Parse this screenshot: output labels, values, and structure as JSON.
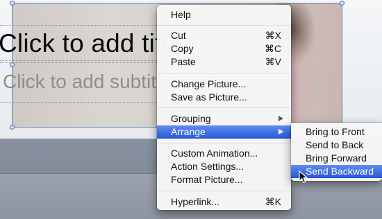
{
  "slide": {
    "title_placeholder": "Click to add title",
    "subtitle_placeholder": "Click to add subtitle"
  },
  "context_menu": {
    "items": [
      {
        "label": "Help",
        "shortcut": ""
      },
      {
        "label": "Cut",
        "shortcut": "⌘X"
      },
      {
        "label": "Copy",
        "shortcut": "⌘C"
      },
      {
        "label": "Paste",
        "shortcut": "⌘V"
      },
      {
        "label": "Change Picture...",
        "shortcut": ""
      },
      {
        "label": "Save as Picture...",
        "shortcut": ""
      },
      {
        "label": "Grouping",
        "shortcut": ""
      },
      {
        "label": "Arrange",
        "shortcut": ""
      },
      {
        "label": "Custom Animation...",
        "shortcut": ""
      },
      {
        "label": "Action Settings...",
        "shortcut": ""
      },
      {
        "label": "Format Picture...",
        "shortcut": ""
      },
      {
        "label": "Hyperlink...",
        "shortcut": "⌘K"
      }
    ],
    "highlighted": "Arrange",
    "submenu_arrow_icon": "chevron-right-icon"
  },
  "arrange_submenu": {
    "items": [
      {
        "label": "Bring to Front"
      },
      {
        "label": "Send to Back"
      },
      {
        "label": "Bring Forward"
      },
      {
        "label": "Send Backward"
      }
    ],
    "highlighted": "Send Backward"
  },
  "colors": {
    "highlight_top": "#5f8bf0",
    "highlight_bottom": "#2658d6",
    "selection_border": "#5d7fb8"
  },
  "cursor_icon": "arrow-pointer-icon"
}
